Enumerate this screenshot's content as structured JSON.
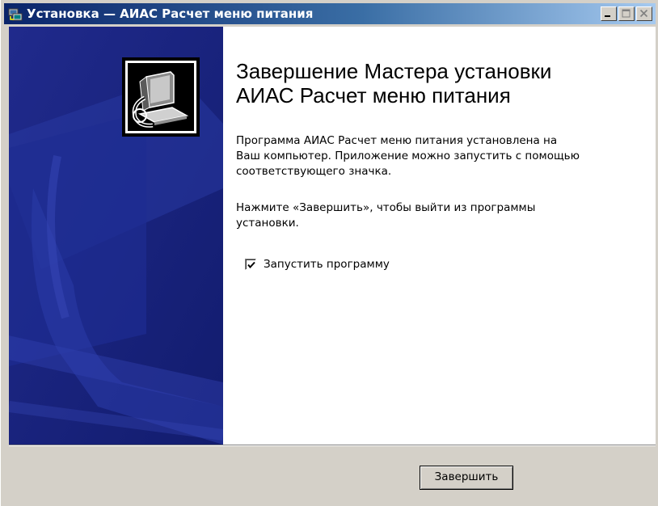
{
  "window": {
    "title": "Установка — АИАС Расчет меню питания",
    "icon": "setup-icon",
    "controls": [
      "minimize-icon",
      "maximize-icon",
      "close-icon"
    ]
  },
  "main": {
    "heading_line1": "Завершение Мастера установки",
    "heading_line2": "АИАС Расчет меню питания",
    "paragraph1": [
      "Программа АИАС Расчет меню питания установлена на",
      "Ваш компьютер. Приложение можно запустить с помощью",
      "соответствующего значка."
    ],
    "paragraph2": [
      "Нажмите «Завершить», чтобы выйти из программы",
      "установки."
    ],
    "checkbox": {
      "label": "Запустить программу",
      "checked": true
    }
  },
  "footer": {
    "finish_label": "Завершить"
  },
  "colors": {
    "titlebar_start": "#0a246a",
    "titlebar_end": "#a6caf0",
    "side_panel": "#1a2a8a",
    "window_face": "#d4d0c8"
  }
}
